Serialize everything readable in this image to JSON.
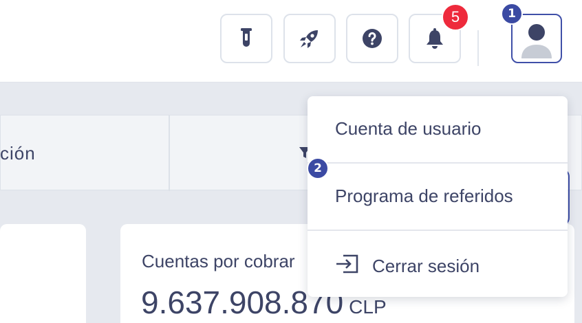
{
  "topbar": {
    "buttons": [
      {
        "name": "lab-flask-icon"
      },
      {
        "name": "rocket-icon"
      },
      {
        "name": "help-icon"
      },
      {
        "name": "bell-icon"
      }
    ],
    "notifications_count": "5",
    "avatar_icon": "user-avatar-icon"
  },
  "markers": {
    "one": "1",
    "two": "2"
  },
  "filter_bar": {
    "label": "ción",
    "icon": "filter-icon"
  },
  "card": {
    "title": "Cuentas por cobrar",
    "value": "9.637.908.870",
    "currency": "CLP"
  },
  "user_menu": {
    "items": [
      {
        "label": "Cuenta de usuario"
      },
      {
        "label": "Programa de referidos"
      },
      {
        "label": "Cerrar sesión",
        "icon": "logout-icon"
      }
    ]
  },
  "colors": {
    "accent": "#3f4fa8",
    "badge": "#ee2a3c",
    "text": "#3d4466",
    "background": "#e6e9ef"
  }
}
